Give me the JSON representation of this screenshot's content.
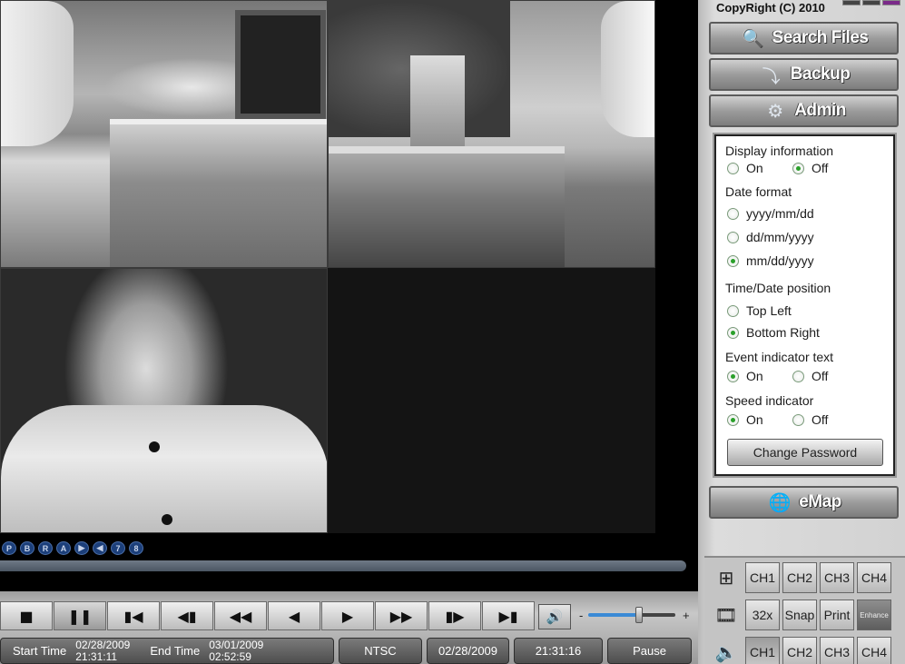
{
  "app": {
    "copyright": "CopyRight (C) 2010"
  },
  "menu": {
    "search_files": "Search Files",
    "backup": "Backup",
    "admin": "Admin",
    "emap": "eMap"
  },
  "admin_panel": {
    "display_info": {
      "heading": "Display information",
      "on": "On",
      "off": "Off",
      "selected": "Off"
    },
    "date_format": {
      "heading": "Date format",
      "options": [
        "yyyy/mm/dd",
        "dd/mm/yyyy",
        "mm/dd/yyyy"
      ],
      "selected": "mm/dd/yyyy"
    },
    "time_date_position": {
      "heading": "Time/Date position",
      "options": [
        "Top Left",
        "Bottom Right"
      ],
      "selected": "Bottom Right"
    },
    "event_indicator": {
      "heading": "Event indicator text",
      "on": "On",
      "off": "Off",
      "selected": "On"
    },
    "speed_indicator": {
      "heading": "Speed indicator",
      "on": "On",
      "off": "Off",
      "selected": "On"
    },
    "change_password": "Change Password"
  },
  "indicators": [
    "P",
    "B",
    "R",
    "A",
    "▶",
    "◀",
    "7",
    "8"
  ],
  "playback": {
    "buttons": [
      "stop",
      "pause",
      "prev-segment",
      "step-back",
      "rewind",
      "play-reverse",
      "play",
      "fast-forward",
      "step-forward",
      "next-segment"
    ],
    "volume_minus": "-",
    "volume_plus": "+",
    "volume_level": 0.57
  },
  "status": {
    "start_label": "Start Time",
    "start_date": "02/28/2009",
    "start_time": "21:31:11",
    "end_label": "End Time",
    "end_date": "03/01/2009",
    "end_time": "02:52:59",
    "format": "NTSC",
    "current_date": "02/28/2009",
    "current_time": "21:31:16",
    "state": "Pause"
  },
  "channels": {
    "row1": [
      "CH1",
      "CH2",
      "CH3",
      "CH4"
    ],
    "row2": [
      "32x",
      "Snap",
      "Print",
      "Enhance"
    ],
    "row3": [
      "CH1",
      "CH2",
      "CH3",
      "CH4"
    ]
  }
}
